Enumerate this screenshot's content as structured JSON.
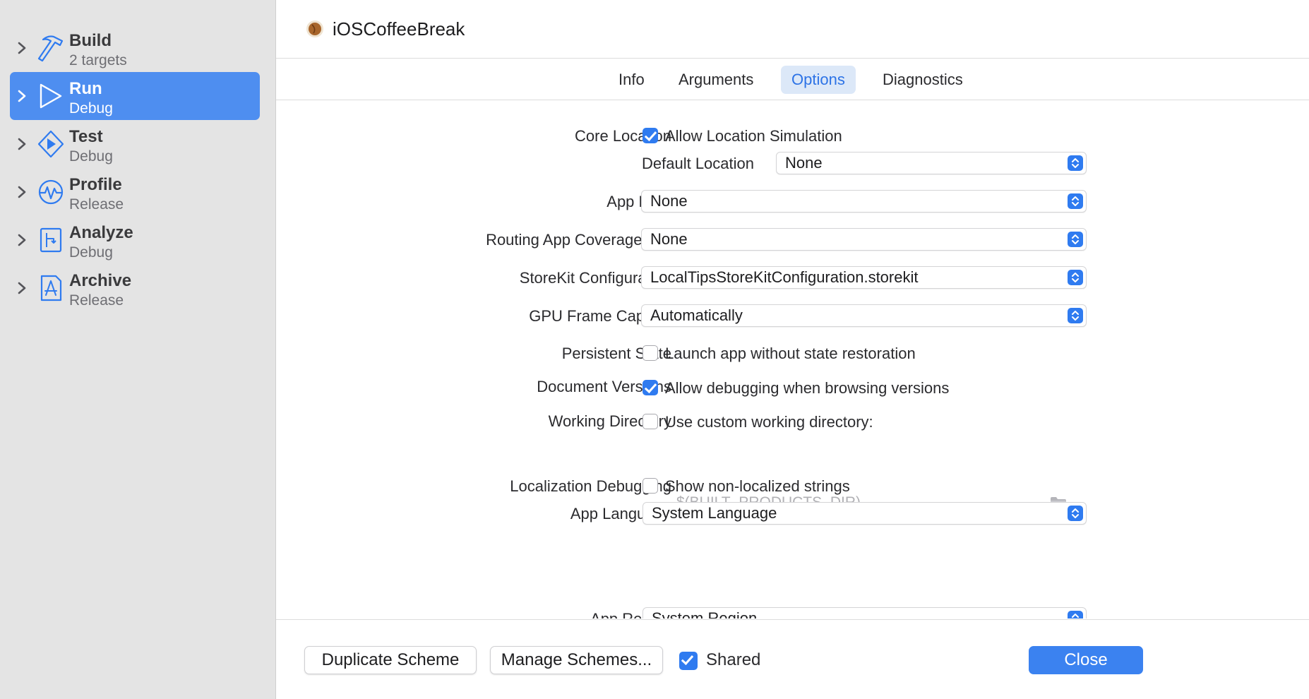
{
  "sidebar": {
    "items": [
      {
        "title": "Build",
        "subtitle": "2 targets",
        "icon": "hammer-icon"
      },
      {
        "title": "Run",
        "subtitle": "Debug",
        "icon": "play-icon"
      },
      {
        "title": "Test",
        "subtitle": "Debug",
        "icon": "diamond-play-icon"
      },
      {
        "title": "Profile",
        "subtitle": "Release",
        "icon": "waveform-icon"
      },
      {
        "title": "Analyze",
        "subtitle": "Debug",
        "icon": "analyze-icon"
      },
      {
        "title": "Archive",
        "subtitle": "Release",
        "icon": "appstore-document-icon"
      }
    ],
    "selected": "Run"
  },
  "header": {
    "scheme_name": "iOSCoffeeBreak"
  },
  "tabs": [
    {
      "label": "Info"
    },
    {
      "label": "Arguments"
    },
    {
      "label": "Options"
    },
    {
      "label": "Diagnostics"
    }
  ],
  "active_tab": "Options",
  "form": {
    "core_location": {
      "label": "Core Location",
      "checkbox_label": "Allow Location Simulation",
      "checked": true,
      "default_location_label": "Default Location",
      "default_location_value": "None"
    },
    "app_data": {
      "label": "App Data",
      "value": "None"
    },
    "routing": {
      "label": "Routing App Coverage File",
      "value": "None"
    },
    "storekit": {
      "label": "StoreKit Configuration",
      "value": "LocalTipsStoreKitConfiguration.storekit"
    },
    "gpu": {
      "label": "GPU Frame Capture",
      "value": "Automatically"
    },
    "persistent_state": {
      "label": "Persistent State",
      "checkbox_label": "Launch app without state restoration",
      "checked": false
    },
    "document_versions": {
      "label": "Document Versions",
      "checkbox_label": "Allow debugging when browsing versions",
      "checked": true
    },
    "working_directory": {
      "label": "Working Directory",
      "checkbox_label": "Use custom working directory:",
      "checked": false,
      "placeholder": "$(BUILT_PRODUCTS_DIR)"
    },
    "localization": {
      "label": "Localization Debugging",
      "checkbox_label": "Show non-localized strings",
      "checked": false
    },
    "app_language": {
      "label": "App Language",
      "value": "System Language"
    },
    "app_region": {
      "label": "App Region",
      "value": "System Region"
    }
  },
  "footer": {
    "duplicate_label": "Duplicate Scheme",
    "manage_label": "Manage Schemes...",
    "shared_label": "Shared",
    "shared_checked": true,
    "close_label": "Close"
  },
  "colors": {
    "accent": "#2f7bf0",
    "selection": "#4e8ef0",
    "sidebar_bg": "#e4e4e4",
    "tab_active_bg": "#dce8f8"
  }
}
